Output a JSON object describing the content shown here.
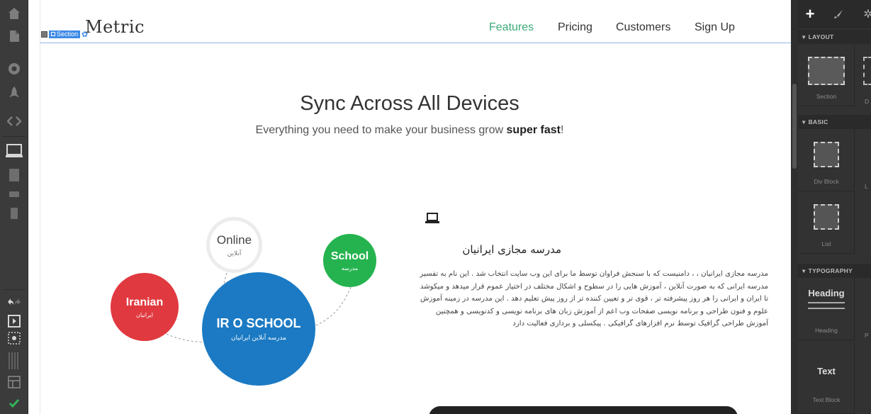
{
  "editor": {
    "section_tag_label": "Section",
    "right_panel": {
      "sections": [
        {
          "title": "LAYOUT",
          "items": [
            {
              "label": "Section"
            },
            {
              "label": "D"
            }
          ]
        },
        {
          "title": "BASIC",
          "items": [
            {
              "label": "Div Block"
            },
            {
              "label": "L"
            },
            {
              "label": "List"
            },
            {
              "label": ""
            }
          ]
        },
        {
          "title": "TYPOGRAPHY",
          "items": [
            {
              "label": "Heading",
              "preview": "Heading"
            },
            {
              "label": "P"
            },
            {
              "label": "Text Block",
              "preview": "Text"
            }
          ]
        }
      ]
    },
    "colors": {
      "selection": "#3d8ae6",
      "toolbar_bg": "#3b3b3b",
      "panel_bg": "#323232"
    }
  },
  "site": {
    "brand": "Metric",
    "nav": [
      "Features",
      "Pricing",
      "Customers",
      "Sign Up"
    ],
    "active_nav": "Features",
    "hero": {
      "title": "Sync Across All Devices",
      "subtitle_pre": "Everything you need to make your business grow ",
      "subtitle_bold": "super fast",
      "subtitle_post": "!"
    },
    "circles": {
      "online": {
        "title": "Online",
        "subtitle": "آنلاین"
      },
      "school": {
        "title": "School",
        "subtitle": "مدرسه"
      },
      "iranian": {
        "title": "Iranian",
        "subtitle": "ایرانیان"
      },
      "main": {
        "title": "IR O SCHOOL",
        "subtitle": "مدرسه آنلاین ایرانیان"
      }
    },
    "feature": {
      "title": "مدرسه مجازی ایرانیان",
      "body": "مدرسه مجازی ایرانیان ، ، دامنیست که با سنجش فراوان توسط ما برای این وب سایت انتخاب شد . این نام به تفسیر مدرسه ایرانی که به صورت آنلاین ، آموزش هایی را در سطوح و اشکال مختلف در اختیار عموم قرار میدهد و میکوشد تا ایران و ایرانی را هر روز پیشرفته تر ، قوی تر و تعیین کننده تر از روز پیش تعلیم دهد . این مدرسه در زمینه آموزش علوم و فنون طراحی و برنامه نویسی صفحات وب اعم از آموزش زبان های برنامه نویسی و کدنویسی و همچنین آموزش طراحی گرافیک توسط نرم افزارهای گرافیکی . پیکسلی و برداری فعالیت دارد"
    },
    "colors": {
      "accent_green": "#3cab78",
      "school_green": "#25b34f",
      "iranian_red": "#e0393f",
      "main_blue": "#1b7ac3"
    }
  }
}
